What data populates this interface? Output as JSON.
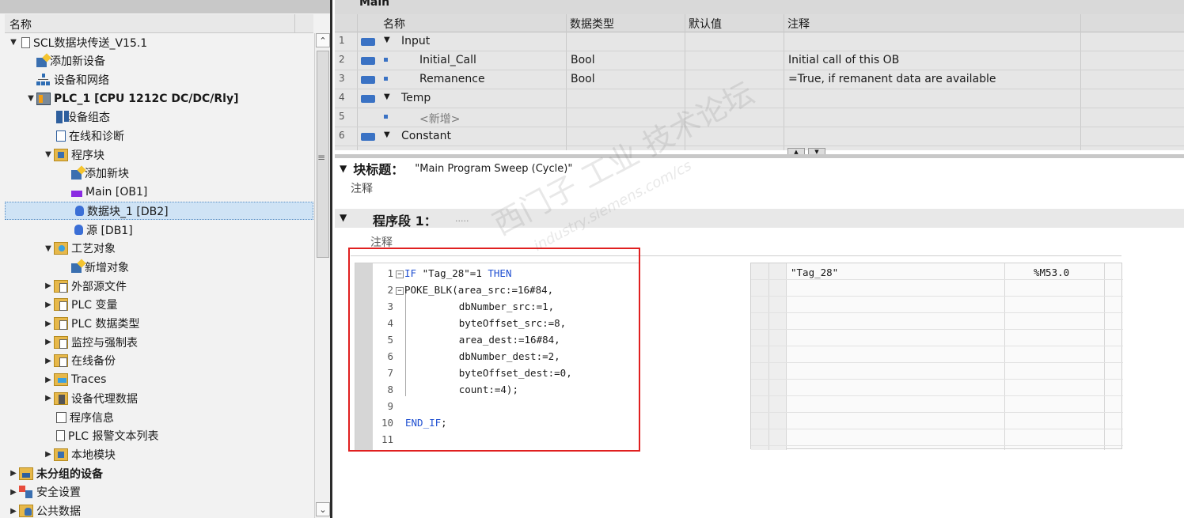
{
  "tree": {
    "header": "名称",
    "items": [
      {
        "label": "SCL数据块传送_V15.1",
        "level": 0,
        "expand": "open",
        "icon": "document-icon",
        "bold": false
      },
      {
        "label": "添加新设备",
        "level": 1,
        "expand": "none",
        "icon": "add-device-icon",
        "bold": false
      },
      {
        "label": "设备和网络",
        "level": 1,
        "expand": "none",
        "icon": "network-icon",
        "bold": false
      },
      {
        "label": "PLC_1 [CPU 1212C DC/DC/Rly]",
        "level": 1,
        "expand": "open",
        "icon": "plc-icon",
        "bold": true
      },
      {
        "label": "设备组态",
        "level": 2,
        "expand": "none",
        "icon": "device-config-icon",
        "bold": false
      },
      {
        "label": "在线和诊断",
        "level": 2,
        "expand": "none",
        "icon": "online-diagnostics-icon",
        "bold": false
      },
      {
        "label": "程序块",
        "level": 2,
        "expand": "open",
        "icon": "program-blocks-folder-icon",
        "bold": false
      },
      {
        "label": "添加新块",
        "level": 3,
        "expand": "none",
        "icon": "add-block-icon",
        "bold": false
      },
      {
        "label": "Main [OB1]",
        "level": 3,
        "expand": "none",
        "icon": "ob-block-icon",
        "bold": false
      },
      {
        "label": "数据块_1 [DB2]",
        "level": 3,
        "expand": "none",
        "icon": "data-block-icon",
        "bold": false,
        "selected": true
      },
      {
        "label": "源 [DB1]",
        "level": 3,
        "expand": "none",
        "icon": "data-block-icon",
        "bold": false
      },
      {
        "label": "工艺对象",
        "level": 2,
        "expand": "open",
        "icon": "technology-objects-icon",
        "bold": false
      },
      {
        "label": "新增对象",
        "level": 3,
        "expand": "none",
        "icon": "add-object-icon",
        "bold": false
      },
      {
        "label": "外部源文件",
        "level": 2,
        "expand": "closed",
        "icon": "external-source-icon",
        "bold": false
      },
      {
        "label": "PLC 变量",
        "level": 2,
        "expand": "closed",
        "icon": "plc-tags-icon",
        "bold": false
      },
      {
        "label": "PLC 数据类型",
        "level": 2,
        "expand": "closed",
        "icon": "plc-datatypes-icon",
        "bold": false
      },
      {
        "label": "监控与强制表",
        "level": 2,
        "expand": "closed",
        "icon": "watch-force-tables-icon",
        "bold": false
      },
      {
        "label": "在线备份",
        "level": 2,
        "expand": "closed",
        "icon": "online-backup-icon",
        "bold": false
      },
      {
        "label": "Traces",
        "level": 2,
        "expand": "closed",
        "icon": "traces-icon",
        "bold": false
      },
      {
        "label": "设备代理数据",
        "level": 2,
        "expand": "closed",
        "icon": "device-proxy-icon",
        "bold": false
      },
      {
        "label": "程序信息",
        "level": 2,
        "expand": "none",
        "icon": "program-info-icon",
        "bold": false
      },
      {
        "label": "PLC 报警文本列表",
        "level": 2,
        "expand": "none",
        "icon": "alarm-text-list-icon",
        "bold": false
      },
      {
        "label": "本地模块",
        "level": 2,
        "expand": "closed",
        "icon": "local-modules-icon",
        "bold": false
      },
      {
        "label": "未分组的设备",
        "level": 0,
        "expand": "closed",
        "icon": "ungrouped-devices-icon",
        "bold": true
      },
      {
        "label": "安全设置",
        "level": 0,
        "expand": "closed",
        "icon": "security-settings-icon",
        "bold": false
      },
      {
        "label": "公共数据",
        "level": 0,
        "expand": "closed",
        "icon": "common-data-icon",
        "bold": false
      }
    ]
  },
  "editor": {
    "title": "Main",
    "interface": {
      "headers": {
        "name": "名称",
        "datatype": "数据类型",
        "default": "默认值",
        "comment": "注释"
      },
      "rows": [
        {
          "num": "1",
          "name": "Input",
          "section": true,
          "datatype": "",
          "comment": ""
        },
        {
          "num": "2",
          "name": "Initial_Call",
          "section": false,
          "datatype": "Bool",
          "comment": "Initial call of this OB"
        },
        {
          "num": "3",
          "name": "Remanence",
          "section": false,
          "datatype": "Bool",
          "comment": "=True, if remanent data are available"
        },
        {
          "num": "4",
          "name": "Temp",
          "section": true,
          "datatype": "",
          "comment": ""
        },
        {
          "num": "5",
          "name": "<新增>",
          "section": false,
          "placeholder": true,
          "datatype": "",
          "comment": ""
        },
        {
          "num": "6",
          "name": "Constant",
          "section": true,
          "datatype": "",
          "comment": ""
        }
      ]
    },
    "block_title_label": "块标题：",
    "block_title_value": "\"Main Program Sweep (Cycle)\"",
    "block_comment": "注释",
    "network_label": "程序段 1：",
    "network_dots": ".....",
    "network_comment": "注释",
    "code_lines": [
      {
        "n": "1",
        "fold": "⊟",
        "parts": [
          {
            "t": "IF",
            "c": "kw"
          },
          {
            "t": " \"Tag_28\"=1 ",
            "c": "str"
          },
          {
            "t": "THEN",
            "c": "kw"
          }
        ]
      },
      {
        "n": "2",
        "fold": "⊟",
        "parts": [
          {
            "t": "POKE_BLK(area_src:=16#84,",
            "c": "fn"
          }
        ]
      },
      {
        "n": "3",
        "fold": "",
        "parts": [
          {
            "t": "         dbNumber_src:=1,",
            "c": "fn"
          }
        ]
      },
      {
        "n": "4",
        "fold": "",
        "parts": [
          {
            "t": "         byteOffset_src:=8,",
            "c": "fn"
          }
        ]
      },
      {
        "n": "5",
        "fold": "",
        "parts": [
          {
            "t": "         area_dest:=16#84,",
            "c": "fn"
          }
        ]
      },
      {
        "n": "6",
        "fold": "",
        "parts": [
          {
            "t": "         dbNumber_dest:=2,",
            "c": "fn"
          }
        ]
      },
      {
        "n": "7",
        "fold": "",
        "parts": [
          {
            "t": "         byteOffset_dest:=0,",
            "c": "fn"
          }
        ]
      },
      {
        "n": "8",
        "fold": "",
        "parts": [
          {
            "t": "         count:=4);",
            "c": "fn"
          }
        ]
      },
      {
        "n": "9",
        "fold": "",
        "parts": [
          {
            "t": "",
            "c": "fn"
          }
        ]
      },
      {
        "n": "10",
        "fold": "",
        "parts": [
          {
            "t": "END_IF",
            "c": "kw"
          },
          {
            "t": ";",
            "c": "fn"
          }
        ]
      },
      {
        "n": "11",
        "fold": "",
        "parts": [
          {
            "t": "",
            "c": "fn"
          }
        ]
      }
    ],
    "xref": [
      {
        "name": "\"Tag_28\"",
        "addr": "%M53.0"
      }
    ]
  },
  "watermark": {
    "line1": "西门子 工业 技术论坛",
    "line2": "industry.siemens.com/cs"
  },
  "colors": {
    "keyword": "#1f4fd1",
    "highlight_box": "#e02020",
    "selection": "#cfe3f5"
  }
}
